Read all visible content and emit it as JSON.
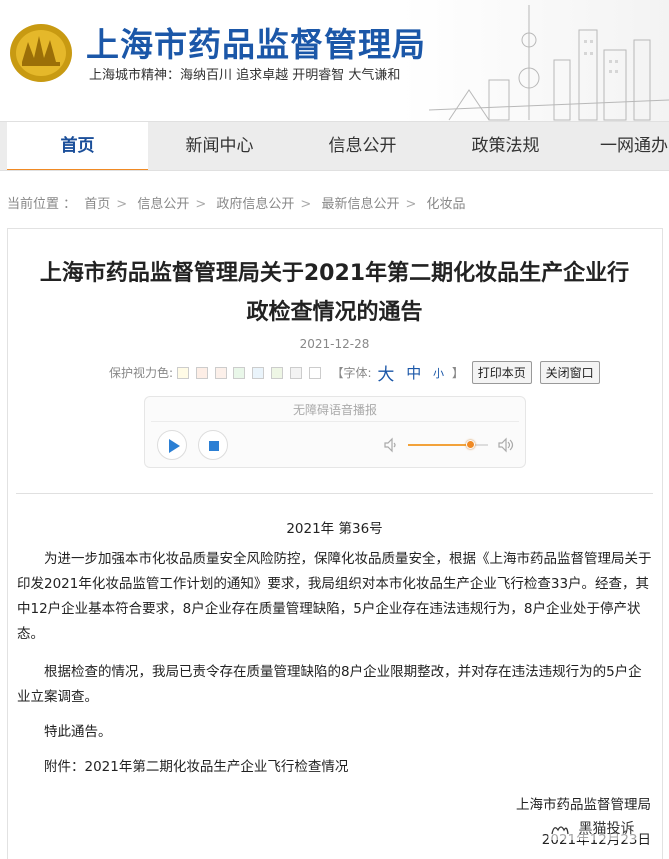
{
  "header": {
    "site_title": "上海市药品监督管理局",
    "spirit": "上海城市精神：海纳百川  追求卓越  开明睿智  大气谦和",
    "logo_text": "上海"
  },
  "nav": {
    "items": [
      {
        "label": "首页",
        "active": true
      },
      {
        "label": "新闻中心",
        "active": false
      },
      {
        "label": "信息公开",
        "active": false
      },
      {
        "label": "政策法规",
        "active": false
      },
      {
        "label": "一网通办",
        "active": false
      }
    ]
  },
  "breadcrumb": {
    "prefix": "当前位置 ：",
    "items": [
      "首页",
      "信息公开",
      "政府信息公开",
      "最新信息公开",
      "化妆品"
    ]
  },
  "article": {
    "title_line1": "上海市药品监督管理局关于2021年第二期化妆品生产企业行",
    "title_line2": "政检查情况的通告",
    "date": "2021-12-28",
    "tools": {
      "color_label": "保护视力色:",
      "swatch_colors": [
        "#fffbe6",
        "#fdeee6",
        "#fcf0ea",
        "#e9f7e9",
        "#eaf4fb",
        "#eef6e5",
        "#f3f3f3",
        "#ffffff"
      ],
      "font_label": "【字体:",
      "font_big": "大",
      "font_mid": "中",
      "font_small": "小",
      "bracket_close": "】",
      "print_button": "打印本页",
      "close_button": "关闭窗口"
    },
    "player": {
      "title": "无障碍语音播报",
      "volume_level": 0.78,
      "accent": "#2b7fd4"
    },
    "doc_number": "2021年 第36号",
    "paragraphs": [
      "为进一步加强本市化妆品质量安全风险防控，保障化妆品质量安全，根据《上海市药品监督管理局关于印发2021年化妆品监管工作计划的通知》要求，我局组织对本市化妆品生产企业飞行检查33户。经查，其中12户企业基本符合要求，8户企业存在质量管理缺陷，5户企业存在违法违规行为，8户企业处于停产状态。",
      "根据检查的情况，我局已责令存在质量管理缺陷的8户企业限期整改，并对存在违法违规行为的5户企业立案调查。",
      "特此通告。",
      "附件：2021年第二期化妆品生产企业飞行检查情况"
    ],
    "signature": "上海市药品监督管理局",
    "sign_date": "2021年12月23日"
  },
  "watermark": {
    "text": "黑猫投诉"
  }
}
